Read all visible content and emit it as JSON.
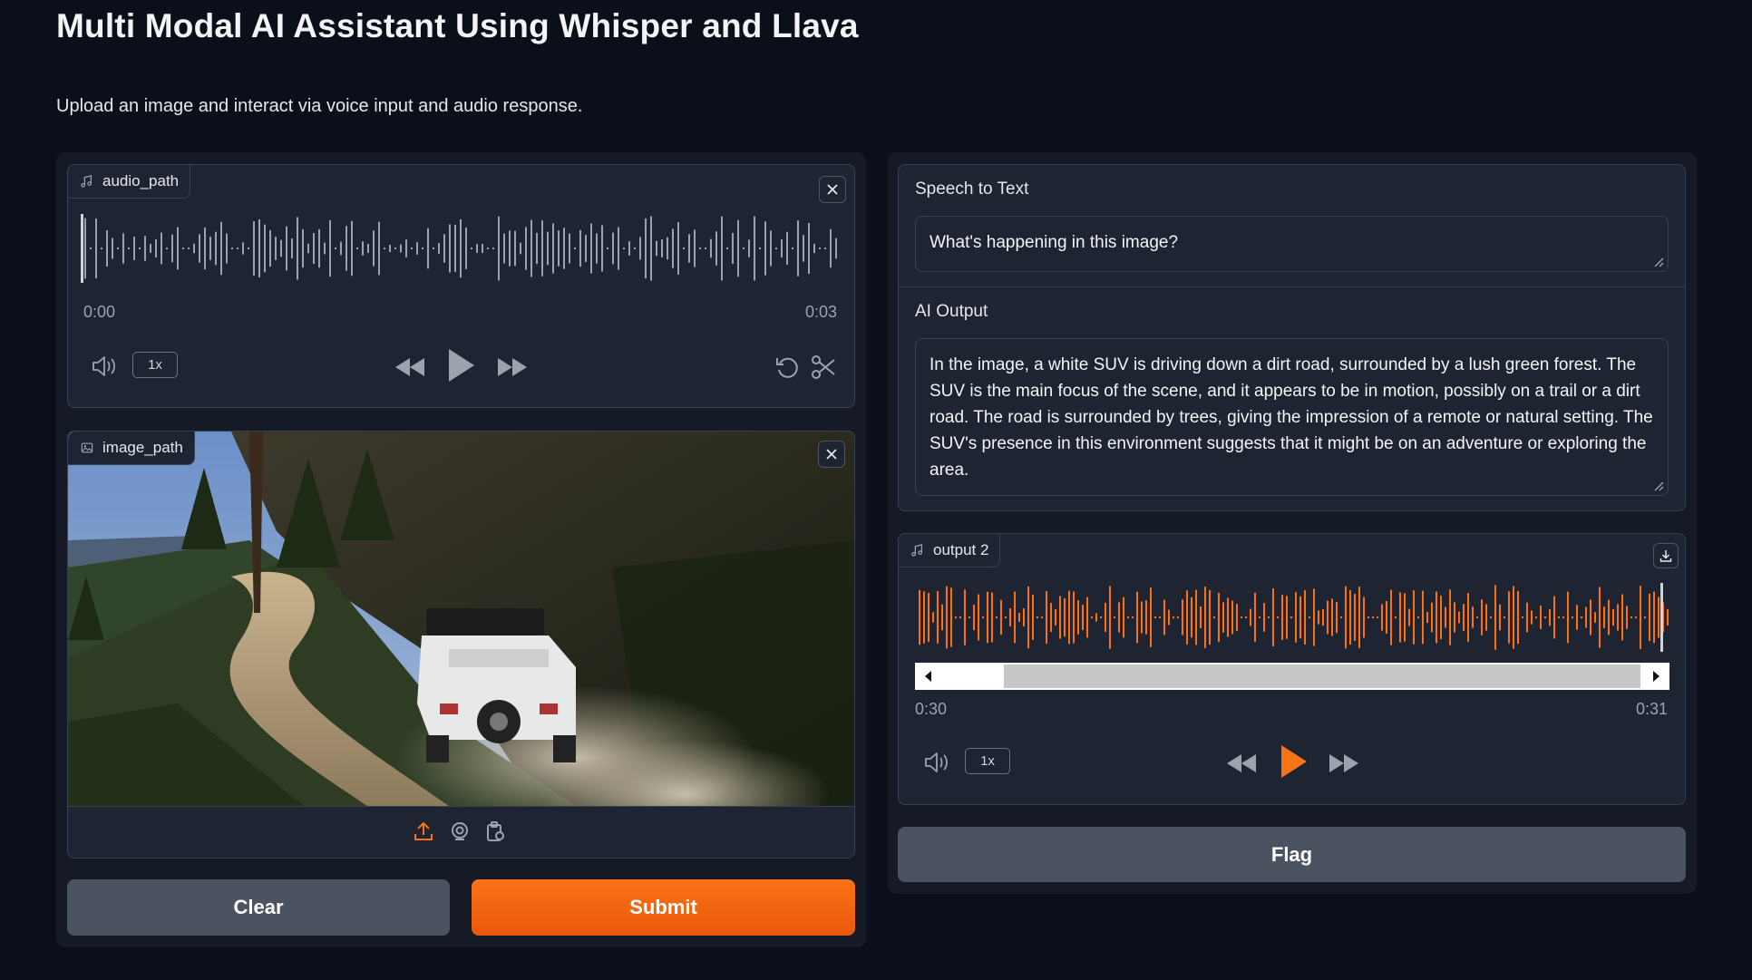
{
  "page": {
    "title": "Multi Modal AI Assistant Using Whisper and Llava",
    "description": "Upload an image and interact via voice input and audio response."
  },
  "audio_input": {
    "label": "audio_path",
    "time_start": "0:00",
    "time_end": "0:03",
    "playback_rate": "1x"
  },
  "image_input": {
    "label": "image_path"
  },
  "buttons": {
    "clear": "Clear",
    "submit": "Submit",
    "flag": "Flag"
  },
  "speech_to_text": {
    "label": "Speech to Text",
    "value": "What's happening in this image?"
  },
  "ai_output": {
    "label": "AI Output",
    "value": "In the image, a white SUV is driving down a dirt road, surrounded by a lush green forest. The SUV is the main focus of the scene, and it appears to be in motion, possibly on a trail or a dirt road. The road is surrounded by trees, giving the impression of a remote or natural setting. The SUV's presence in this environment suggests that it might be on an adventure or exploring the area."
  },
  "audio_output": {
    "label": "output 2",
    "time_current": "0:30",
    "time_end": "0:31",
    "playback_rate": "1x"
  },
  "colors": {
    "accent": "#f97316",
    "background": "#0b0f19",
    "panel": "#151a26",
    "block": "#1f2432"
  }
}
